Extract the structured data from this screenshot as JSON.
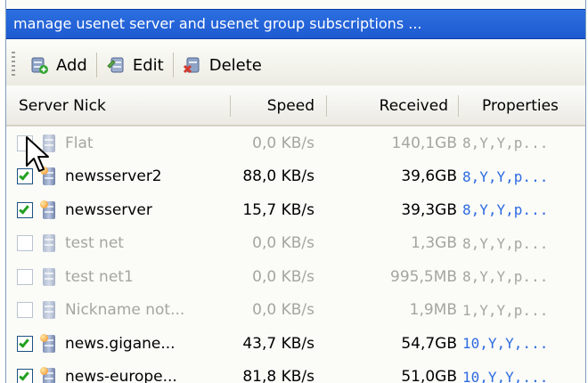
{
  "window": {
    "title": "manage usenet server and usenet group subscriptions ..."
  },
  "toolbar": {
    "add_label": "Add",
    "edit_label": "Edit",
    "delete_label": "Delete"
  },
  "columns": [
    "Server Nick",
    "Speed",
    "Received",
    "Properties"
  ],
  "rows": [
    {
      "checked": false,
      "enabled": false,
      "nick": "Flat",
      "speed": "0,0 KB/s",
      "received": "140,1GB",
      "properties": "8,Y,Y,p..."
    },
    {
      "checked": true,
      "enabled": true,
      "nick": "newsserver2",
      "speed": "88,0 KB/s",
      "received": "39,6GB",
      "properties": "8,Y,Y,p..."
    },
    {
      "checked": true,
      "enabled": true,
      "nick": "newsserver",
      "speed": "15,7 KB/s",
      "received": "39,3GB",
      "properties": "8,Y,Y,p..."
    },
    {
      "checked": false,
      "enabled": false,
      "nick": "test net",
      "speed": "0,0 KB/s",
      "received": "1,3GB",
      "properties": "8,Y,Y,p..."
    },
    {
      "checked": false,
      "enabled": false,
      "nick": "test net1",
      "speed": "0,0 KB/s",
      "received": "995,5MB",
      "properties": "8,Y,Y,p..."
    },
    {
      "checked": false,
      "enabled": false,
      "nick": "Nickname not...",
      "speed": "0,0 KB/s",
      "received": "1,9MB",
      "properties": "1,Y,Y,p..."
    },
    {
      "checked": true,
      "enabled": true,
      "nick": "news.gigane...",
      "speed": "43,7 KB/s",
      "received": "54,7GB",
      "properties": "10,Y,Y,..."
    },
    {
      "checked": true,
      "enabled": true,
      "nick": "news-europe...",
      "speed": "81,8 KB/s",
      "received": "51,0GB",
      "properties": "10,Y,Y,..."
    }
  ],
  "colors": {
    "title_bg": "#2c6fe0",
    "enabled_props": "#2d6be0",
    "disabled_text": "#a6a6a0",
    "check": "#21a121"
  },
  "icons": {
    "add": "add-server-icon",
    "edit": "edit-server-icon",
    "delete": "delete-server-icon",
    "server": "server-icon"
  }
}
